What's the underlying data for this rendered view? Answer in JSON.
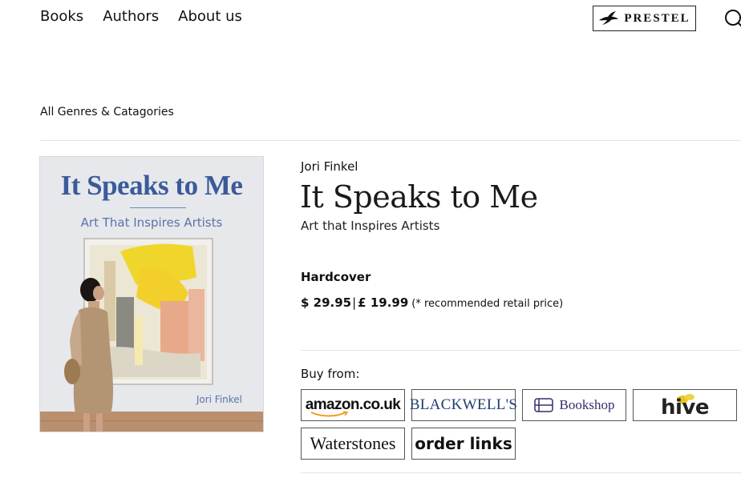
{
  "nav": {
    "items": [
      "Books",
      "Authors",
      "About us"
    ]
  },
  "logo": {
    "text": "PRESTEL"
  },
  "icons": {
    "search": "search-icon",
    "logo_mark": "bird-icon"
  },
  "breadcrumb": "All Genres & Catagories",
  "cover": {
    "title": "It Speaks to Me",
    "subtitle": "Art That Inspires Artists",
    "author": "Jori Finkel"
  },
  "book": {
    "author": "Jori Finkel",
    "title": "It Speaks to Me",
    "subtitle": "Art that Inspires Artists",
    "format": "Hardcover",
    "price_usd": "$ 29.95",
    "price_sep": "|",
    "price_gbp": "£ 19.99",
    "price_note": "(* recommended retail price)"
  },
  "buy": {
    "label": "Buy from:",
    "shops": {
      "amazon": "amazon.co.uk",
      "blackwells": "BLACKWELL'S",
      "bookshop": "Bookshop",
      "hive": "hive",
      "waterstones": "Waterstones",
      "order_links": "order links"
    }
  },
  "colors": {
    "cover_blue": "#3b5a9a",
    "bookshop_purple": "#3b2a6b",
    "blackwells_blue": "#1f3b73",
    "hive_leaf": "#e6c622"
  }
}
